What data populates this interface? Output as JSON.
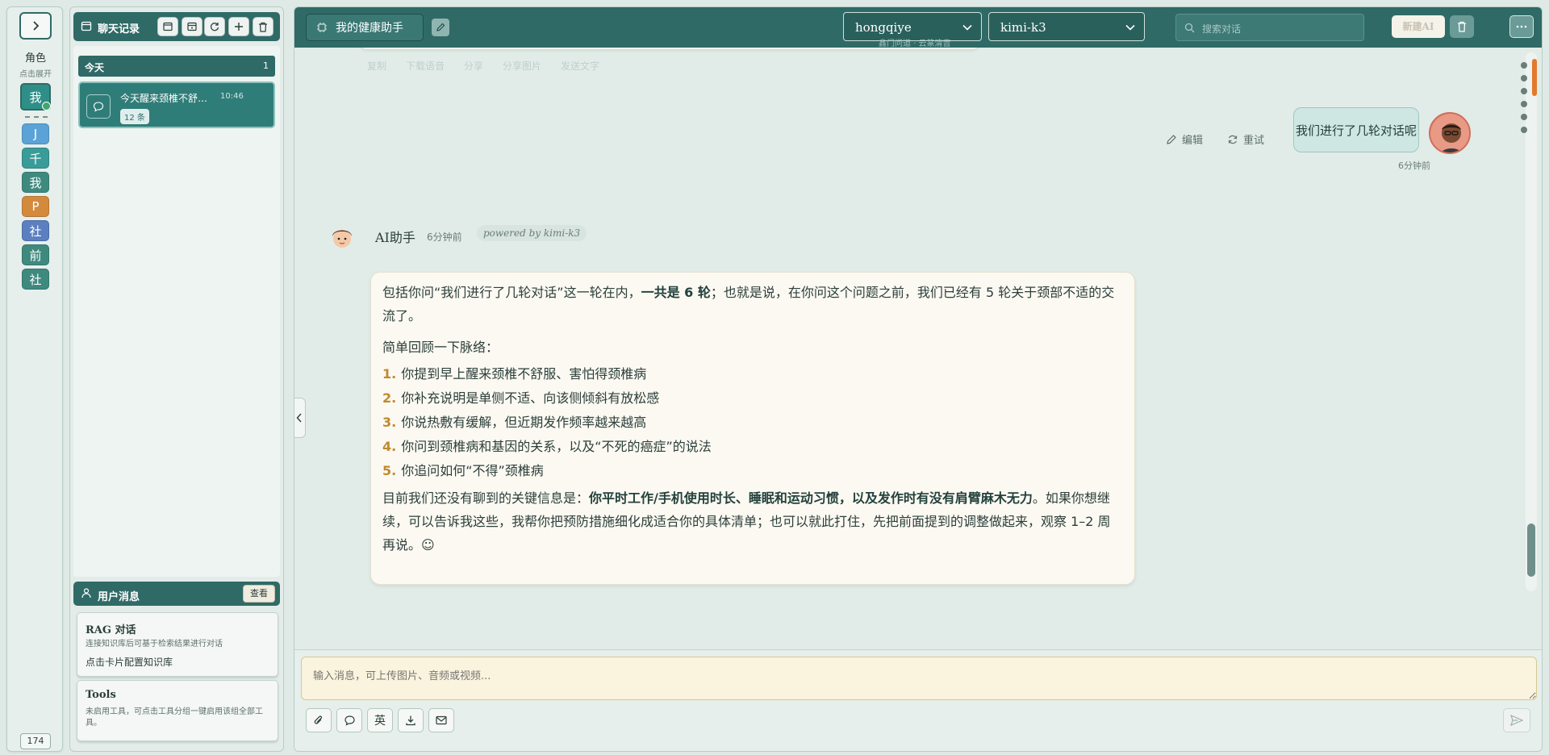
{
  "role_rail": {
    "label": "角色",
    "sub": "点击展开",
    "current": "我",
    "roles": [
      {
        "char": "J",
        "color": "#5ba3d6"
      },
      {
        "char": "千",
        "color": "#3a9c98"
      },
      {
        "char": "我",
        "color": "#3f8a7e"
      },
      {
        "char": "P",
        "color": "#d48a3c"
      },
      {
        "char": "社",
        "color": "#5b7fc0"
      },
      {
        "char": "前",
        "color": "#3f8a7e"
      },
      {
        "char": "社",
        "color": "#3f8a7e"
      }
    ],
    "count": "174"
  },
  "history": {
    "title": "聊天记录",
    "group_label": "今天",
    "group_count": "1",
    "conversation": {
      "title": "今天醒来颈椎不舒…",
      "time": "10:46",
      "badge": "12 条"
    }
  },
  "user_messages": {
    "title": "用户消息",
    "view_label": "查看",
    "rag_title": "RAG 对话",
    "rag_desc": "连接知识库后可基于检索结果进行对话",
    "rag_action": "点击卡片配置知识库",
    "tools_title": "Tools",
    "tools_desc": "未启用工具，可点击工具分组一键启用该组全部工具。"
  },
  "topbar": {
    "assistant_title": "我的健康助手",
    "provider": "hongqiye",
    "provider_sub": "鑫门问道 · 云篆清音",
    "model": "kimi-k3",
    "search_placeholder": "搜索对话",
    "new_ai_label": "新建AI"
  },
  "prev_actions": "复制　　下载语音　　分享　　分享图片　　发送文字",
  "user_msg": {
    "text": "我们进行了几轮对话呢",
    "time": "6分钟前",
    "edit_label": "编辑",
    "retry_label": "重试"
  },
  "ai_msg": {
    "name": "AI助手",
    "time": "6分钟前",
    "powered": "powered by kimi-k3",
    "p1_a": "包括你问“我们进行了几轮对话”这一轮在内，",
    "p1_bold": "一共是 6 轮",
    "p1_b": "；也就是说，在你问这个问题之前，我们已经有 5 轮关于颈部不适的交流了。",
    "p2": "简单回顾一下脉络：",
    "items": [
      {
        "n": "1.",
        "t": "你提到早上醒来颈椎不舒服、害怕得颈椎病"
      },
      {
        "n": "2.",
        "t": "你补充说明是单侧不适、向该侧倾斜有放松感"
      },
      {
        "n": "3.",
        "t": "你说热敷有缓解，但近期发作频率越来越高"
      },
      {
        "n": "4.",
        "t": "你问到颈椎病和基因的关系，以及“不死的癌症”的说法"
      },
      {
        "n": "5.",
        "t": "你追问如何“不得”颈椎病"
      }
    ],
    "p3_a": "目前我们还没有聊到的关键信息是：",
    "p3_bold": "你平时工作/手机使用时长、睡眠和运动习惯，以及发作时有没有肩臂麻木无力",
    "p3_b": "。如果你想继续，可以告诉我这些，我帮你把预防措施细化成适合你的具体清单；也可以就此打住，先把前面提到的调整做起来，观察 1–2 周再说。☺"
  },
  "composer": {
    "placeholder": "输入消息，可上传图片、音频或视频...",
    "lang_label": "英"
  }
}
